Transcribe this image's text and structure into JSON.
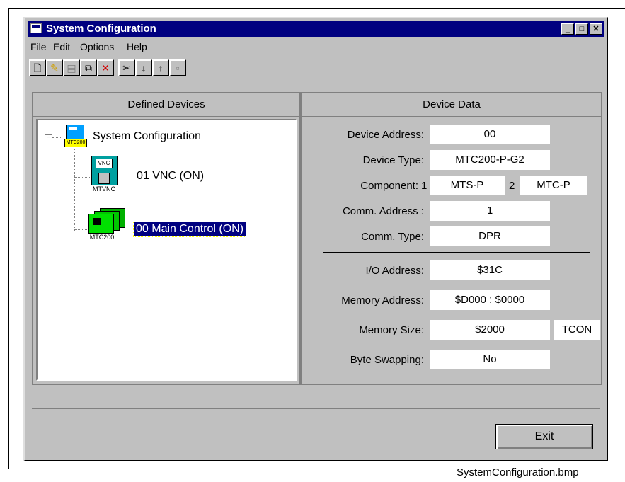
{
  "window": {
    "title": "System Configuration",
    "caption": "SystemConfiguration.bmp"
  },
  "menu": [
    "File",
    "Edit",
    "Options",
    "Help"
  ],
  "toolbar": [
    {
      "name": "new-icon",
      "glyph": "🗋"
    },
    {
      "name": "edit-icon",
      "glyph": "✎"
    },
    {
      "name": "paste-icon",
      "glyph": "▤"
    },
    {
      "name": "copy-icon",
      "glyph": "⧉"
    },
    {
      "name": "delete-icon",
      "glyph": "✕"
    },
    {
      "name": "cut-icon",
      "glyph": "✂"
    },
    {
      "name": "move-down-icon",
      "glyph": "↓"
    },
    {
      "name": "move-up-icon",
      "glyph": "↑"
    },
    {
      "name": "properties-icon",
      "glyph": "▫"
    }
  ],
  "left_pane": {
    "header": "Defined Devices",
    "root": {
      "label": "System Configuration",
      "expander": "−",
      "icon_label": "MTC200"
    },
    "children": [
      {
        "label": "01  VNC  (ON)",
        "icon_top": "VNC",
        "icon_label": "MTVNC",
        "selected": false
      },
      {
        "label": "00  Main Control  (ON)",
        "icon_label": "MTC200",
        "selected": true
      }
    ]
  },
  "right_pane": {
    "header": "Device Data",
    "device_address_label": "Device Address:",
    "device_address": "00",
    "device_type_label": "Device Type:",
    "device_type": "MTC200-P-G2",
    "component_label": "Component:",
    "component1_num": "1",
    "component1": "MTS-P",
    "component2_num": "2",
    "component2": "MTC-P",
    "comm_address_label": "Comm. Address :",
    "comm_address": "1",
    "comm_type_label": "Comm. Type:",
    "comm_type": "DPR",
    "io_address_label": "I/O Address:",
    "io_address": "$31C",
    "memory_address_label": "Memory Address:",
    "memory_address": "$D000 : $0000",
    "memory_size_label": "Memory Size:",
    "memory_size": "$2000",
    "memory_size_extra": "TCON",
    "byte_swapping_label": "Byte Swapping:",
    "byte_swapping": "No"
  },
  "exit_label": "Exit"
}
